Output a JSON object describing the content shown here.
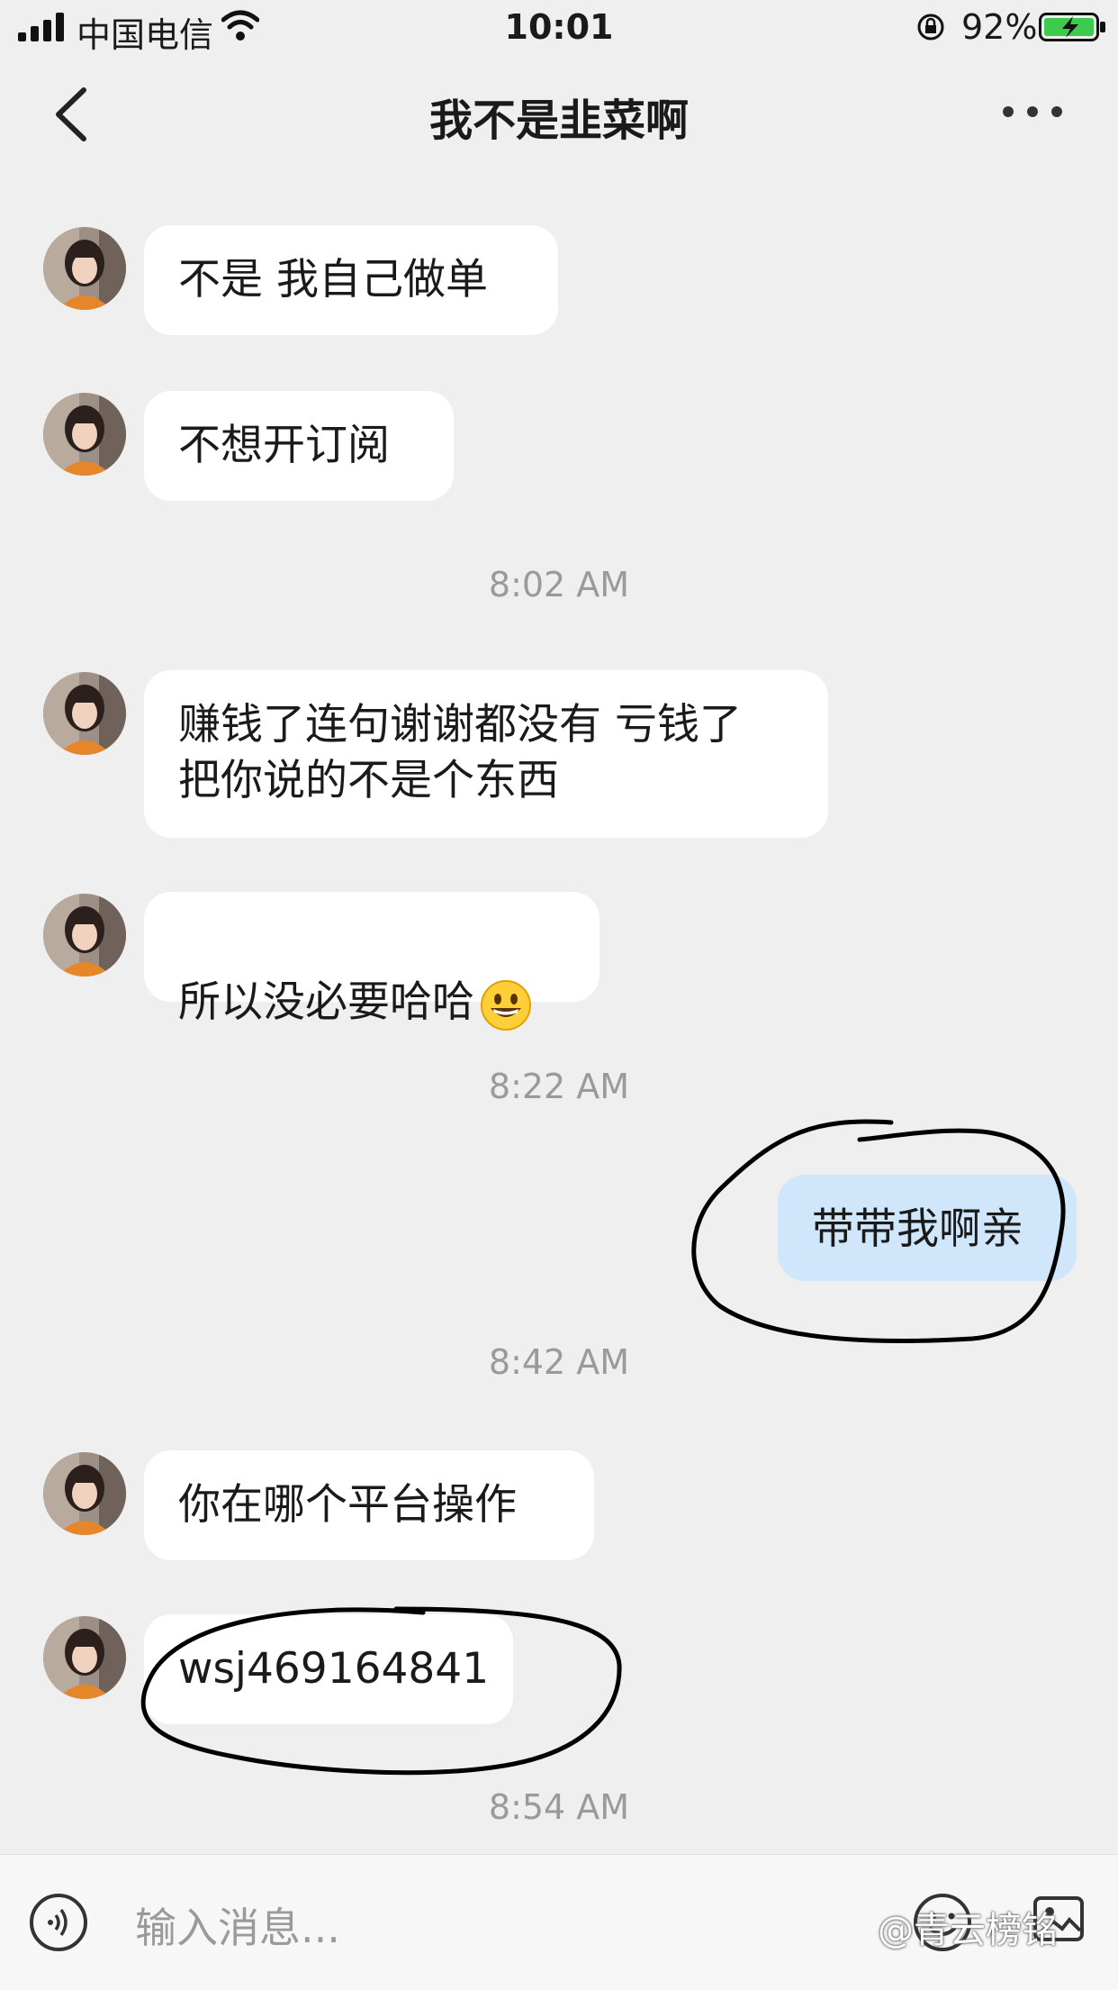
{
  "status": {
    "carrier": "中国电信",
    "time": "10:01",
    "battery": "92%"
  },
  "nav": {
    "title": "我不是韭菜啊",
    "back_icon": "chevron-left-icon",
    "more_icon": "more-dots-icon"
  },
  "messages": [
    {
      "side": "left",
      "text": "不是 我自己做单"
    },
    {
      "side": "left",
      "text": "不想开订阅"
    },
    {
      "side": "time",
      "text": "8:02 AM"
    },
    {
      "side": "left",
      "text": "赚钱了连句谢谢都没有 亏钱了\n把你说的不是个东西"
    },
    {
      "side": "left",
      "text": "所以没必要哈哈",
      "emoji": "grinning-face-emoji"
    },
    {
      "side": "time",
      "text": "8:22 AM"
    },
    {
      "side": "right",
      "text": "带带我啊亲"
    },
    {
      "side": "time",
      "text": "8:42 AM"
    },
    {
      "side": "left",
      "text": "你在哪个平台操作"
    },
    {
      "side": "left",
      "text": "wsj469164841"
    },
    {
      "side": "time",
      "text": "8:54 AM"
    }
  ],
  "input": {
    "placeholder": "输入消息..."
  },
  "watermark": "@青云榜铭",
  "colors": {
    "background": "#efeff0",
    "bubble_in": "#ffffff",
    "bubble_out": "#cfe6fb",
    "timestamp": "#9a9a9a"
  }
}
